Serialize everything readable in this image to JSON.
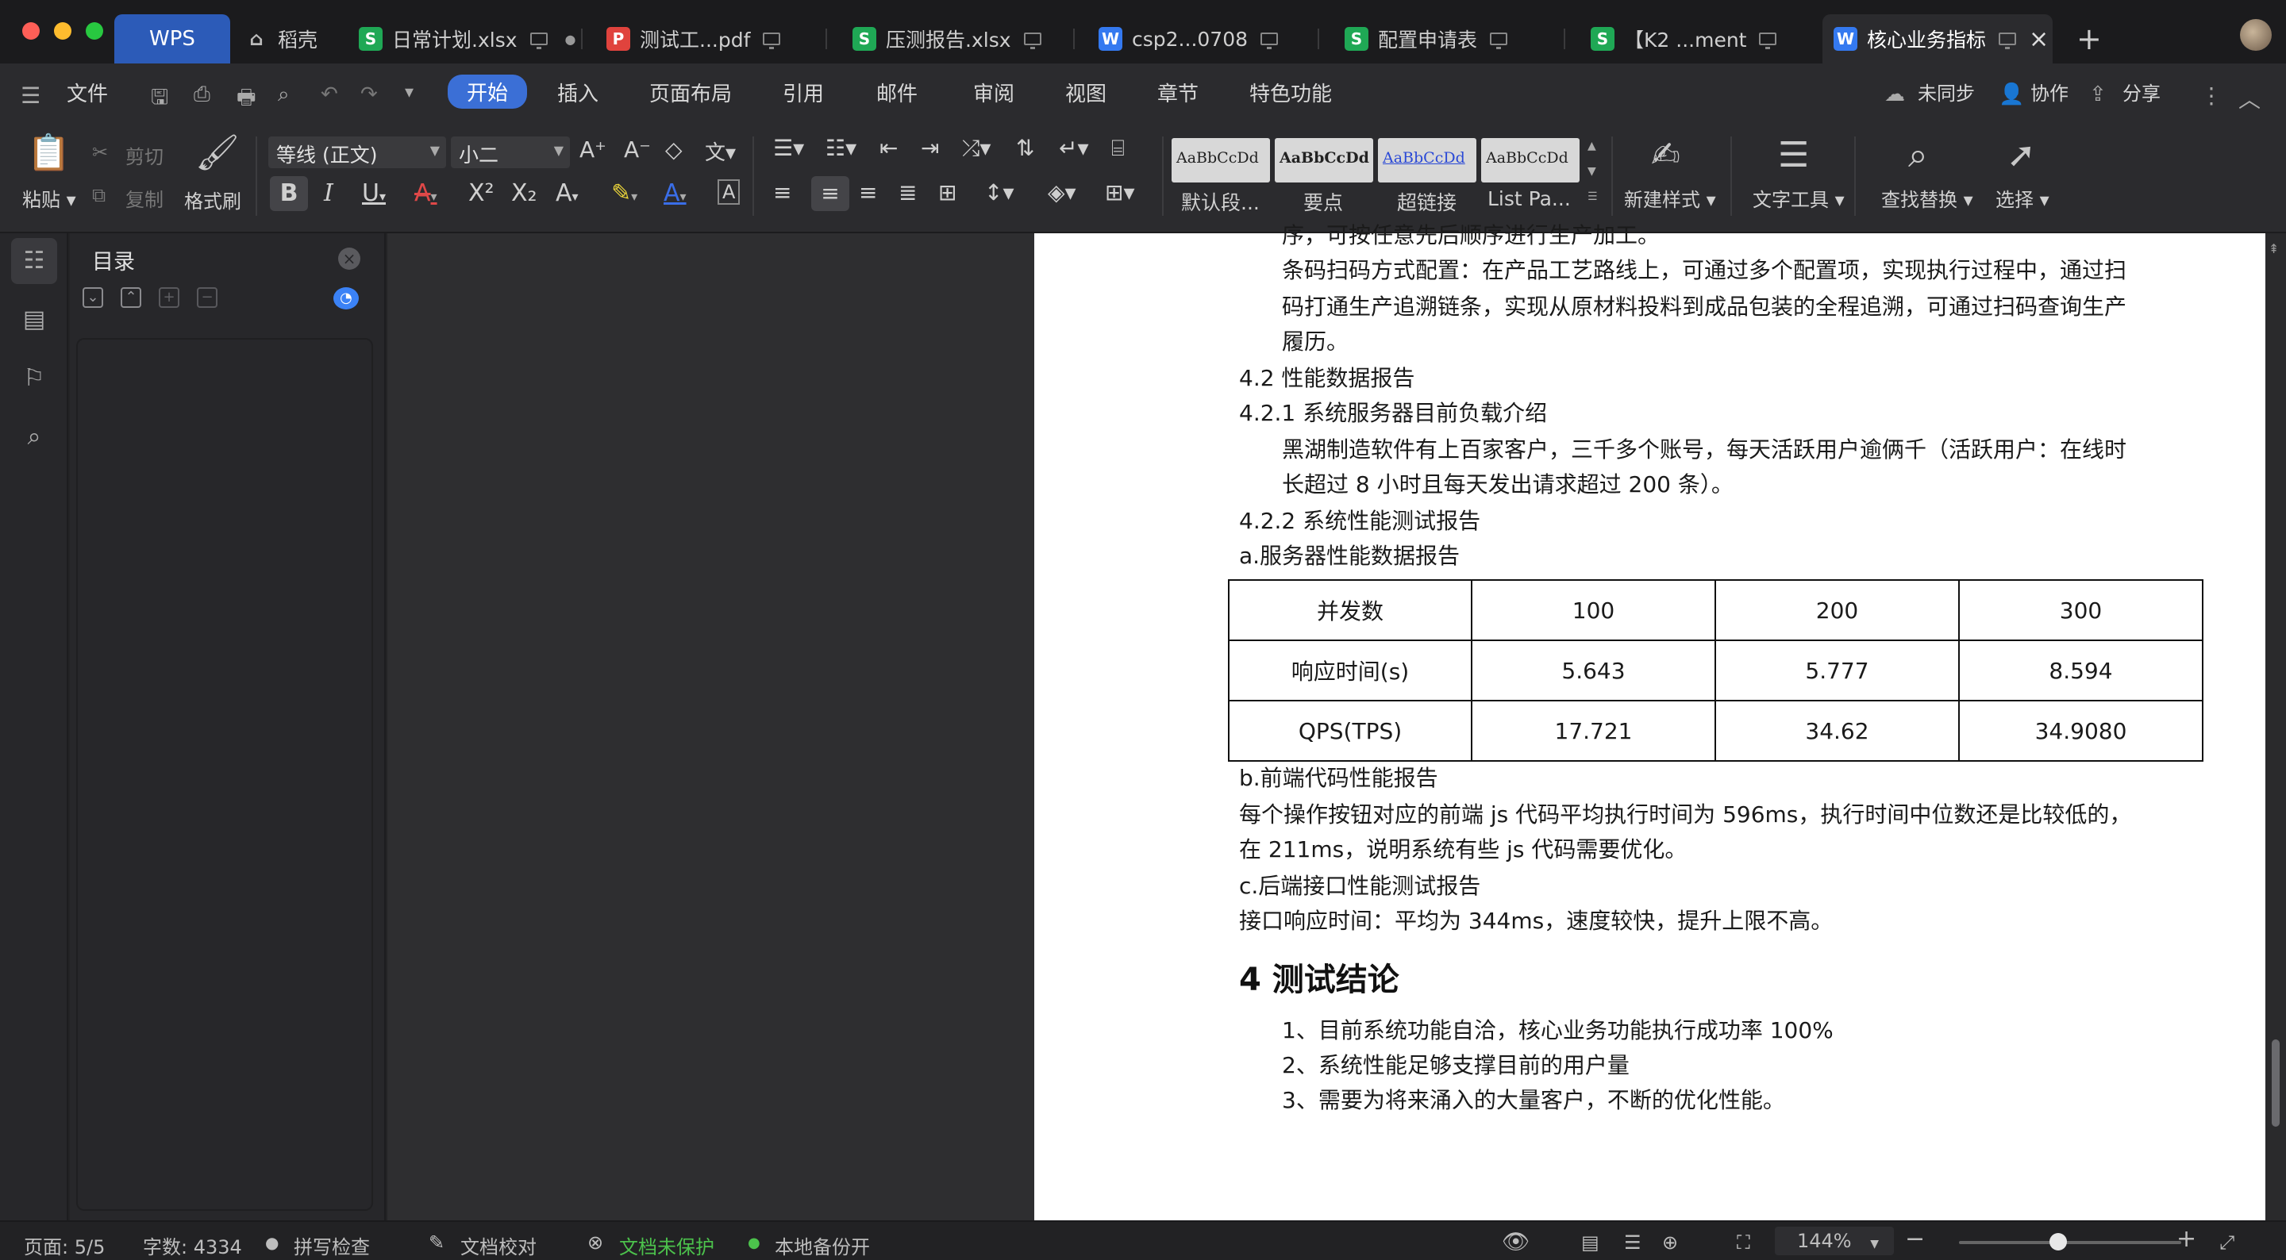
{
  "tabs": [
    {
      "label": "WPS"
    },
    {
      "label": "稻壳"
    },
    {
      "label": "日常计划.xlsx"
    },
    {
      "label": "测试工...pdf"
    },
    {
      "label": "压测报告.xlsx"
    },
    {
      "label": "csp2...0708"
    },
    {
      "label": "配置申请表"
    },
    {
      "label": "【K2 ...ment"
    },
    {
      "label": "核心业务指标"
    }
  ],
  "menu": {
    "file": "文件",
    "items": [
      "开始",
      "插入",
      "页面布局",
      "引用",
      "邮件",
      "审阅",
      "视图",
      "章节",
      "特色功能"
    ],
    "right": {
      "sync": "未同步",
      "collab": "协作",
      "share": "分享"
    }
  },
  "ribbon": {
    "paste": "粘贴",
    "cut": "剪切",
    "copy": "复制",
    "format_painter": "格式刷",
    "font_name": "等线 (正文)",
    "font_size": "小二",
    "styles": [
      {
        "preview": "AaBbCcDd",
        "label": "默认段..."
      },
      {
        "preview": "AaBbCcDd",
        "label": "要点"
      },
      {
        "preview": "AaBbCcDd",
        "label": "超链接"
      },
      {
        "preview": "AaBbCcDd",
        "label": "List Pa..."
      }
    ],
    "new_style": "新建样式",
    "text_tools": "文字工具",
    "find_replace": "查找替换",
    "select": "选择"
  },
  "outline": {
    "title": "目录"
  },
  "document": {
    "lines": [
      "序，可按任意先后顺序进行生产加工。",
      "条码扫码方式配置：在产品工艺路线上，可通过多个配置项，实现执行过程中，通过扫",
      "码打通生产追溯链条，实现从原材料投料到成品包装的全程追溯，可通过扫码查询生产",
      "履历。",
      "4.2 性能数据报告",
      "4.2.1 系统服务器目前负载介绍",
      "黑湖制造软件有上百家客户，三千多个账号，每天活跃用户逾俩千（活跃用户：在线时",
      "长超过 8 小时且每天发出请求超过 200 条）。",
      "4.2.2 系统性能测试报告",
      "a.服务器性能数据报告"
    ],
    "table": {
      "rows": [
        [
          "并发数",
          "100",
          "200",
          "300"
        ],
        [
          "响应时间(s)",
          "5.643",
          "5.777",
          "8.594"
        ],
        [
          "QPS(TPS)",
          "17.721",
          "34.62",
          "34.9080"
        ]
      ]
    },
    "after_table": [
      "b.前端代码性能报告",
      "每个操作按钮对应的前端 js 代码平均执行时间为 596ms，执行时间中位数还是比较低的，",
      "在 211ms，说明系统有些 js 代码需要优化。",
      "c.后端接口性能测试报告",
      "接口响应时间：平均为 344ms，速度较快，提升上限不高。"
    ],
    "heading": "4 测试结论",
    "conclusions": [
      "1、目前系统功能自洽，核心业务功能执行成功率 100%",
      "2、系统性能足够支撑目前的用户量",
      "3、需要为将来涌入的大量客户，不断的优化性能。"
    ]
  },
  "status": {
    "page": "页面: 5/5",
    "words": "字数: 4334",
    "spell": "拼写检查",
    "proof": "文档校对",
    "protect": "文档未保护",
    "backup": "本地备份开",
    "zoom": "144%"
  }
}
